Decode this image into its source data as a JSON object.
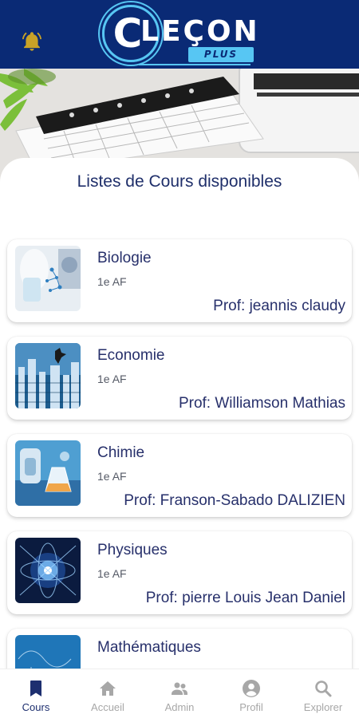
{
  "header": {
    "logo_text": "LEÇON",
    "logo_sub": "PLUS",
    "logo_letter": "C"
  },
  "colors": {
    "header_bg": "#0a2a75",
    "accent": "#57c6f3",
    "bell": "#c9a227",
    "title_text": "#1f2f6a",
    "nav_active": "#1d2f6f",
    "nav_inactive": "#a7a7a7"
  },
  "main": {
    "title": "Listes de Cours disponibles",
    "courses": [
      {
        "name": "Biologie",
        "level": "1e AF",
        "prof": "Prof: jeannis claudy"
      },
      {
        "name": "Economie",
        "level": "1e AF",
        "prof": "Prof: Williamson Mathias"
      },
      {
        "name": "Chimie",
        "level": "1e AF",
        "prof": "Prof: Franson-Sabado DALIZIEN"
      },
      {
        "name": "Physiques",
        "level": "1e AF",
        "prof": "Prof: pierre Louis Jean Daniel"
      },
      {
        "name": "Mathématiques",
        "level": "",
        "prof": ""
      }
    ]
  },
  "nav": {
    "items": [
      {
        "label": "Cours",
        "icon": "bookmark-icon",
        "active": true
      },
      {
        "label": "Accueil",
        "icon": "home-icon",
        "active": false
      },
      {
        "label": "Admin",
        "icon": "people-icon",
        "active": false
      },
      {
        "label": "Profil",
        "icon": "account-circle-icon",
        "active": false
      },
      {
        "label": "Explorer",
        "icon": "search-icon",
        "active": false
      }
    ]
  }
}
